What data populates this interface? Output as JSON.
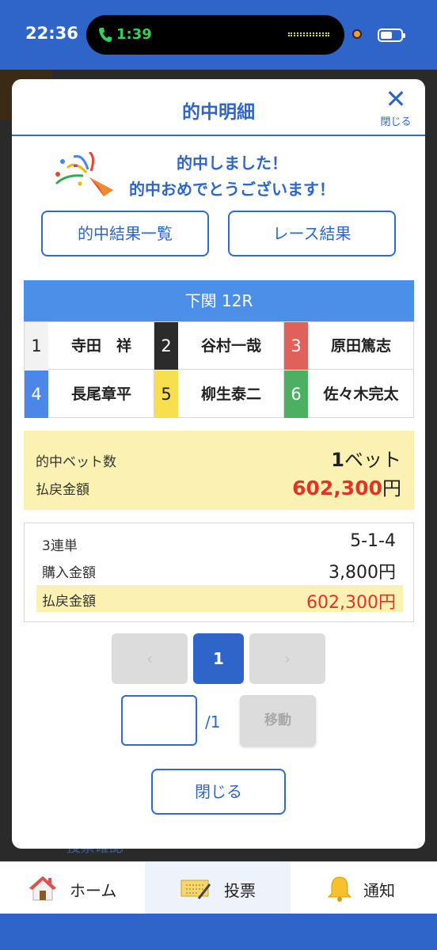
{
  "status_bar": {
    "time": "22:36",
    "call_time": "1:39"
  },
  "background": {
    "partial_link": "投票確認"
  },
  "modal": {
    "title": "的中明細",
    "close_label": "閉じる",
    "message_line1": "的中しました！",
    "message_line2": "的中おめでとうございます！",
    "buttons": {
      "results_list": "的中結果一覧",
      "race_result": "レース結果"
    },
    "race": {
      "header": "下関 12R",
      "racers": [
        {
          "lane": "1",
          "name": "寺田　祥",
          "color": "#f2f2f2",
          "text_color": "#222222"
        },
        {
          "lane": "2",
          "name": "谷村一哉",
          "color": "#2b2b2b",
          "text_color": "#ffffff"
        },
        {
          "lane": "3",
          "name": "原田篤志",
          "color": "#e0605a",
          "text_color": "#ffffff"
        },
        {
          "lane": "4",
          "name": "長尾章平",
          "color": "#4b86e8",
          "text_color": "#ffffff"
        },
        {
          "lane": "5",
          "name": "柳生泰二",
          "color": "#f7df4f",
          "text_color": "#222222"
        },
        {
          "lane": "6",
          "name": "佐々木完太",
          "color": "#4caf62",
          "text_color": "#ffffff"
        }
      ]
    },
    "summary": {
      "bet_count_label": "的中ベット数",
      "bet_count": "1",
      "bet_unit": "ベット",
      "payout_label": "払戻金額",
      "payout": "602,300",
      "yen": "円"
    },
    "detail": {
      "bet_type": "3連単",
      "combination": "5-1-4",
      "purchase_label": "購入金額",
      "purchase_amount": "3,800円",
      "payout_label": "払戻金額",
      "payout_amount": "602,300円"
    },
    "pagination": {
      "prev": "‹",
      "current": "1",
      "next": "›",
      "total": "/1",
      "input_value": "",
      "move_label": "移動"
    },
    "close_button": "閉じる"
  },
  "tabbar": {
    "home": "ホーム",
    "vote": "投票",
    "notice": "通知"
  },
  "colors": {
    "brand_blue": "#2f65c8",
    "payout_red": "#e2332a",
    "highlight_yellow": "#fbf1b2"
  }
}
